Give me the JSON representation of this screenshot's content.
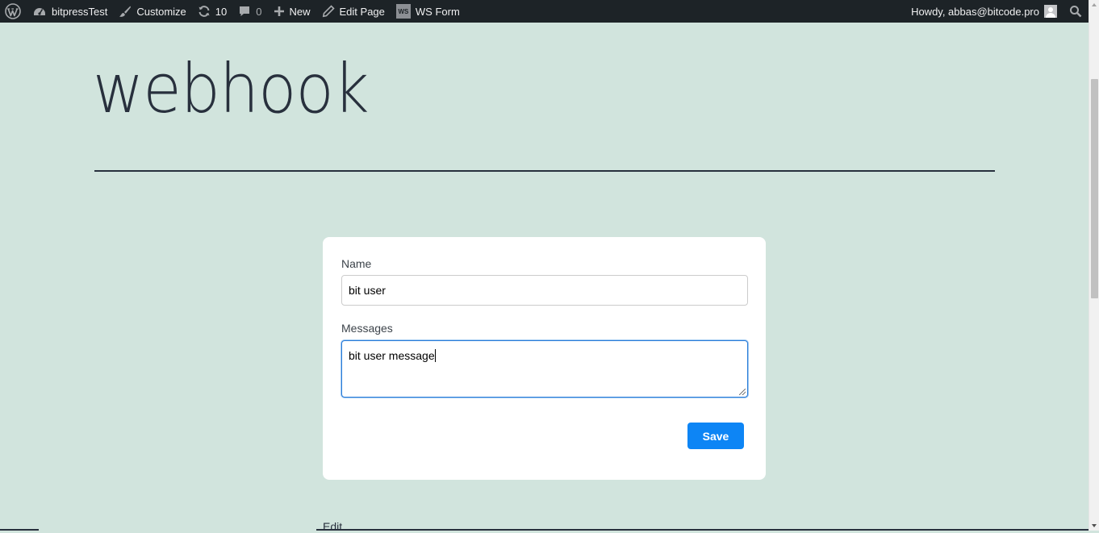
{
  "adminbar": {
    "site_name": "bitpressTest",
    "customize": "Customize",
    "updates_count": "10",
    "comments_count": "0",
    "new_label": "New",
    "edit_page": "Edit Page",
    "ws_logo_text": "WS",
    "ws_form": "WS Form",
    "howdy": "Howdy, abbas@bitcode.pro"
  },
  "page": {
    "title": "webhook",
    "edit_link": "Edit"
  },
  "form": {
    "name_label": "Name",
    "name_value": "bit user",
    "messages_label": "Messages",
    "messages_value": "bit user message",
    "save_label": "Save"
  },
  "colors": {
    "background": "#d1e4dd",
    "adminbar": "#1d2327",
    "button": "#0d85f5",
    "text": "#28303d"
  }
}
